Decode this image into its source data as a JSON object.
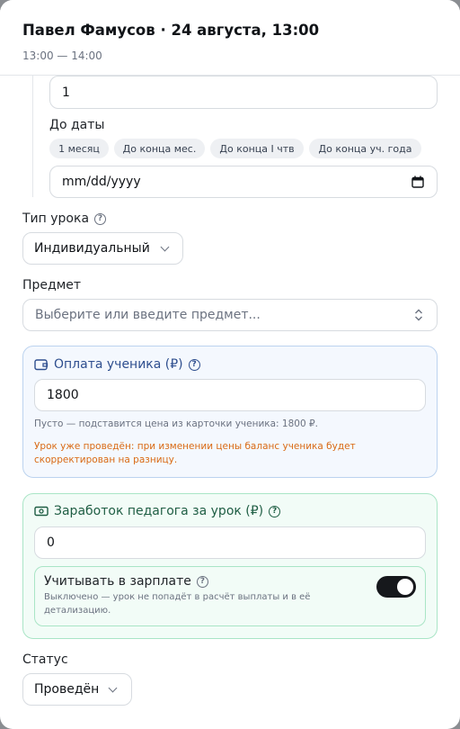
{
  "header": {
    "title": "Павел Фамусов · 24 августа, 13:00",
    "time_range": "13:00 — 14:00"
  },
  "repeat": {
    "count_value": "1",
    "until_label": "До даты",
    "quick_chips": [
      "1 месяц",
      "До конца мес.",
      "До конца I чтв",
      "До конца уч. года"
    ],
    "date_placeholder": "mm/dd/yyyy"
  },
  "lesson_type": {
    "label": "Тип урока",
    "value": "Индивидуальный"
  },
  "subject": {
    "label": "Предмет",
    "placeholder": "Выберите или введите предмет..."
  },
  "student_payment": {
    "title": "Оплата ученика (₽)",
    "value": "1800",
    "hint": "Пусто — подставится цена из карточки ученика: 1800 ₽.",
    "warning": "Урок уже проведён: при изменении цены баланс ученика будет скорректирован на разницу.",
    "accent_color": "#2f4f8f",
    "warning_color": "#d96a14"
  },
  "teacher_earnings": {
    "title": "Заработок педагога за урок (₽)",
    "value": "0",
    "accent_color": "#1f5e44",
    "toggle": {
      "label": "Учитывать в зарплате",
      "description": "Выключено — урок не попадёт в расчёт выплаты и в её детализацию.",
      "on": true
    }
  },
  "status": {
    "label": "Статус",
    "value": "Проведён"
  }
}
